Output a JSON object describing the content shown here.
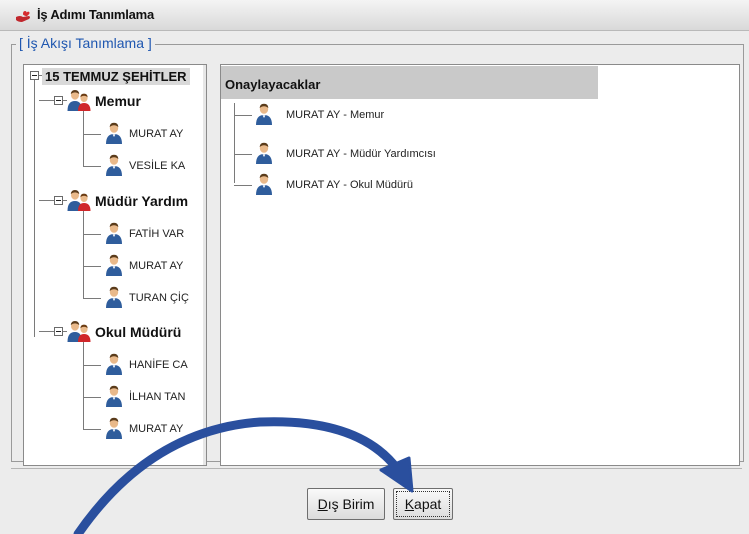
{
  "window": {
    "title": "İş Adımı Tanımlama"
  },
  "group": {
    "legend": "[ İş Akışı Tanımlama ]"
  },
  "tree": {
    "root_label": "15 TEMMUZ ŞEHİTLER",
    "groups": [
      {
        "label": "Memur",
        "people": [
          "MURAT AY",
          "VESİLE KA"
        ]
      },
      {
        "label": "Müdür Yardım",
        "people": [
          "FATİH VAR",
          "MURAT AY",
          "TURAN ÇİÇ"
        ]
      },
      {
        "label": "Okul Müdürü",
        "people": [
          "HANİFE CA",
          "İLHAN TAN",
          "MURAT AY"
        ]
      }
    ]
  },
  "approvers": {
    "header": "Onaylayacaklar",
    "items": [
      "MURAT AY - Memur",
      "MURAT AY - Müdür Yardımcısı",
      "MURAT AY - Okul Müdürü"
    ]
  },
  "buttons": {
    "dis_birim": {
      "mnemonic": "D",
      "rest": "ış Birim"
    },
    "kapat": {
      "mnemonic": "K",
      "rest": "apat"
    }
  },
  "colors": {
    "legend_blue": "#1f57b0",
    "annotation_arrow": "#2a4f9e",
    "person_icon": "#2f5d9c",
    "group_badge_red": "#d0262a"
  },
  "icons": {
    "app": "hand-heart-icon",
    "group": "user-group-icon",
    "person": "user-icon"
  }
}
